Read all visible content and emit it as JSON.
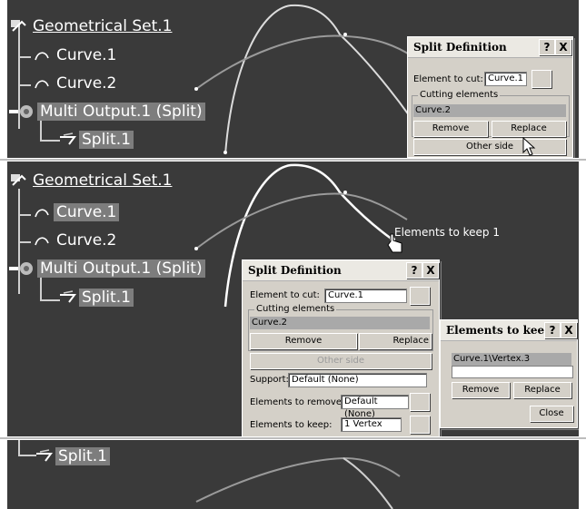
{
  "panel1": {
    "tree": {
      "root": "Geometrical Set.1",
      "curve1": "Curve.1",
      "curve2": "Curve.2",
      "multi": "Multi Output.1 (Split)",
      "split": "Split.1"
    },
    "dialog": {
      "title": "Split Definition",
      "help": "?",
      "close": "X",
      "element_label": "Element to cut:",
      "element_value": "Curve.1",
      "cutting_group": "Cutting elements",
      "cutting_item": "Curve.2",
      "remove": "Remove",
      "replace": "Replace",
      "other_side": "Other side"
    }
  },
  "panel2": {
    "tree": {
      "root": "Geometrical Set.1",
      "curve1": "Curve.1",
      "curve2": "Curve.2",
      "multi": "Multi Output.1 (Split)",
      "split": "Split.1"
    },
    "callout": "Elements to keep 1",
    "dialog": {
      "title": "Split Definition",
      "help": "?",
      "close": "X",
      "element_label": "Element to cut:",
      "element_value": "Curve.1",
      "cutting_group": "Cutting elements",
      "cutting_item": "Curve.2",
      "remove": "Remove",
      "replace": "Replace",
      "other_side": "Other side",
      "support_label": "Support:",
      "support_value": "Default (None)",
      "remove_label": "Elements to remove:",
      "remove_value": "Default (None)",
      "keep_label": "Elements to keep:",
      "keep_value": "1 Vertex"
    },
    "keep_dialog": {
      "title": "Elements to keep",
      "help": "?",
      "close": "X",
      "item": "Curve.1\\Vertex.3",
      "remove": "Remove",
      "replace": "Replace",
      "close_btn": "Close"
    }
  },
  "panel3": {
    "split": "Split.1"
  },
  "colors": {
    "viewport": "#3a3a3a",
    "highlight": "#7d7d7d",
    "dialog_bg": "#d4d0c8"
  }
}
